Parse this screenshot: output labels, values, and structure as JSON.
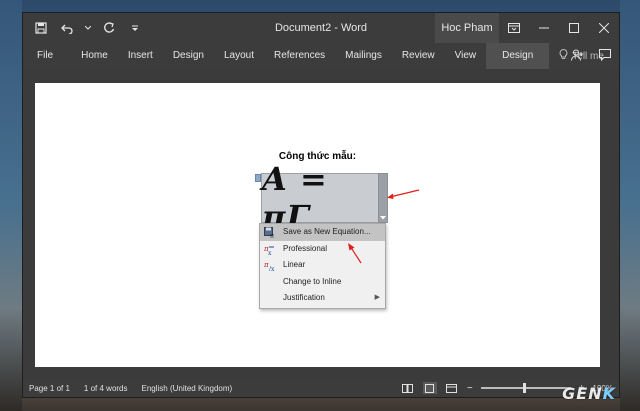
{
  "window": {
    "title": "Document2  -  Word",
    "user": "Hoc Pham"
  },
  "ribbon": {
    "tabs": [
      "File",
      "Home",
      "Insert",
      "Design",
      "Layout",
      "References",
      "Mailings",
      "Review",
      "View"
    ],
    "active_tab": "Design",
    "tell_me": "Tell me"
  },
  "document": {
    "caption": "Công thức mẫu:",
    "equation": "A = πΓ"
  },
  "context_menu": {
    "items": [
      {
        "label": "Save as New Equation...",
        "icon": "save-equation-icon"
      },
      {
        "label": "Professional",
        "icon": "professional-icon"
      },
      {
        "label": "Linear",
        "icon": "linear-icon"
      },
      {
        "label": "Change to Inline",
        "icon": ""
      },
      {
        "label": "Justification",
        "icon": ""
      }
    ]
  },
  "status_bar": {
    "page": "Page 1 of 1",
    "words": "1 of 4 words",
    "language": "English (United Kingdom)",
    "zoom": "100%"
  },
  "watermark": {
    "text": "GEN",
    "accent": "K"
  },
  "colors": {
    "accent_arrow": "#e0211b",
    "title_bar": "#3c3c3c",
    "menu_highlight": "#c3c3c3"
  }
}
